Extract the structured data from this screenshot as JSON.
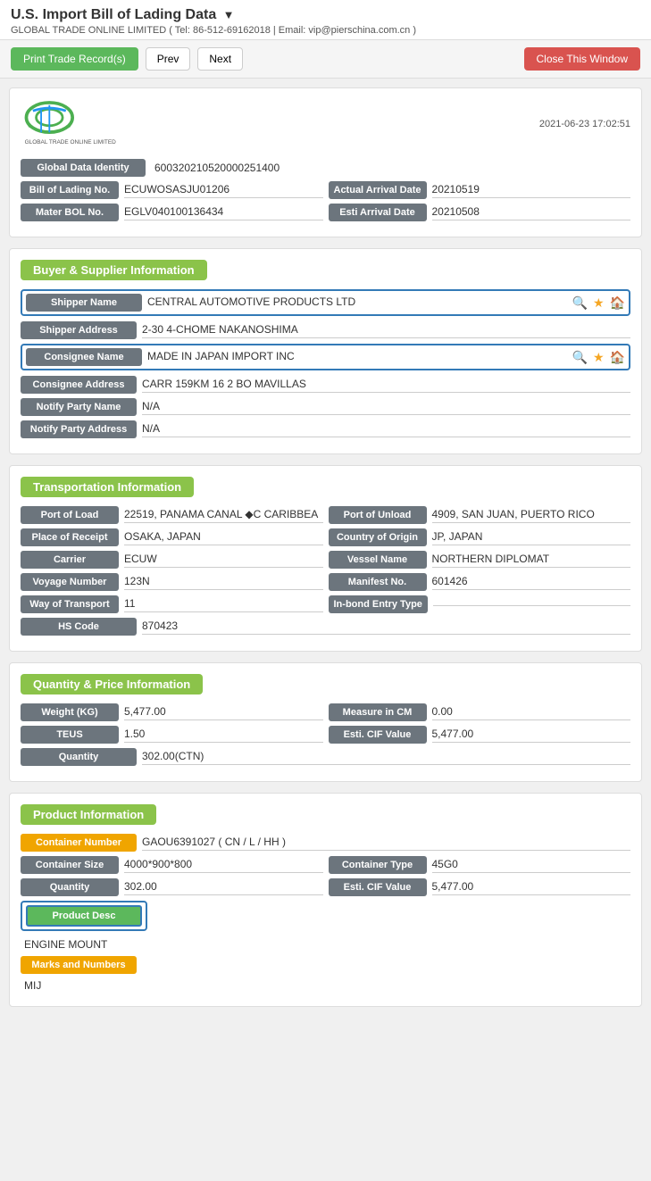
{
  "header": {
    "title": "U.S. Import Bill of Lading Data",
    "subtitle": "GLOBAL TRADE ONLINE LIMITED ( Tel: 86-512-69162018 | Email: vip@pierschina.com.cn )"
  },
  "toolbar": {
    "print_label": "Print Trade Record(s)",
    "prev_label": "Prev",
    "next_label": "Next",
    "close_label": "Close This Window"
  },
  "logo": {
    "timestamp": "2021-06-23 17:02:51"
  },
  "identity": {
    "global_data_label": "Global Data Identity",
    "global_data_value": "600320210520000251400",
    "bol_label": "Bill of Lading No.",
    "bol_value": "ECUWOSASJU01206",
    "actual_arrival_label": "Actual Arrival Date",
    "actual_arrival_value": "20210519",
    "master_bol_label": "Mater BOL No.",
    "master_bol_value": "EGLV040100136434",
    "esti_arrival_label": "Esti Arrival Date",
    "esti_arrival_value": "20210508"
  },
  "buyer_supplier": {
    "section_title": "Buyer & Supplier Information",
    "shipper_name_label": "Shipper Name",
    "shipper_name_value": "CENTRAL AUTOMOTIVE PRODUCTS LTD",
    "shipper_address_label": "Shipper Address",
    "shipper_address_value": "2-30 4-CHOME NAKANOSHIMA",
    "consignee_name_label": "Consignee Name",
    "consignee_name_value": "MADE IN JAPAN IMPORT INC",
    "consignee_address_label": "Consignee Address",
    "consignee_address_value": "CARR 159KM 16 2 BO MAVILLAS",
    "notify_party_label": "Notify Party Name",
    "notify_party_value": "N/A",
    "notify_party_address_label": "Notify Party Address",
    "notify_party_address_value": "N/A"
  },
  "transportation": {
    "section_title": "Transportation Information",
    "port_of_load_label": "Port of Load",
    "port_of_load_value": "22519, PANAMA CANAL ◆C CARIBBEA",
    "port_of_unload_label": "Port of Unload",
    "port_of_unload_value": "4909, SAN JUAN, PUERTO RICO",
    "place_of_receipt_label": "Place of Receipt",
    "place_of_receipt_value": "OSAKA, JAPAN",
    "country_of_origin_label": "Country of Origin",
    "country_of_origin_value": "JP, JAPAN",
    "carrier_label": "Carrier",
    "carrier_value": "ECUW",
    "vessel_name_label": "Vessel Name",
    "vessel_name_value": "NORTHERN DIPLOMAT",
    "voyage_number_label": "Voyage Number",
    "voyage_number_value": "123N",
    "manifest_no_label": "Manifest No.",
    "manifest_no_value": "601426",
    "way_of_transport_label": "Way of Transport",
    "way_of_transport_value": "11",
    "inbond_entry_label": "In-bond Entry Type",
    "inbond_entry_value": "",
    "hs_code_label": "HS Code",
    "hs_code_value": "870423"
  },
  "quantity_price": {
    "section_title": "Quantity & Price Information",
    "weight_label": "Weight (KG)",
    "weight_value": "5,477.00",
    "measure_label": "Measure in CM",
    "measure_value": "0.00",
    "teus_label": "TEUS",
    "teus_value": "1.50",
    "esti_cif_label": "Esti. CIF Value",
    "esti_cif_value": "5,477.00",
    "quantity_label": "Quantity",
    "quantity_value": "302.00(CTN)"
  },
  "product": {
    "section_title": "Product Information",
    "container_number_label": "Container Number",
    "container_number_value": "GAOU6391027 ( CN / L / HH )",
    "container_size_label": "Container Size",
    "container_size_value": "4000*900*800",
    "container_type_label": "Container Type",
    "container_type_value": "45G0",
    "quantity_label": "Quantity",
    "quantity_value": "302.00",
    "esti_cif_label": "Esti. CIF Value",
    "esti_cif_value": "5,477.00",
    "product_desc_label": "Product Desc",
    "product_desc_value": "ENGINE MOUNT",
    "marks_label": "Marks and Numbers",
    "marks_value": "MIJ"
  }
}
